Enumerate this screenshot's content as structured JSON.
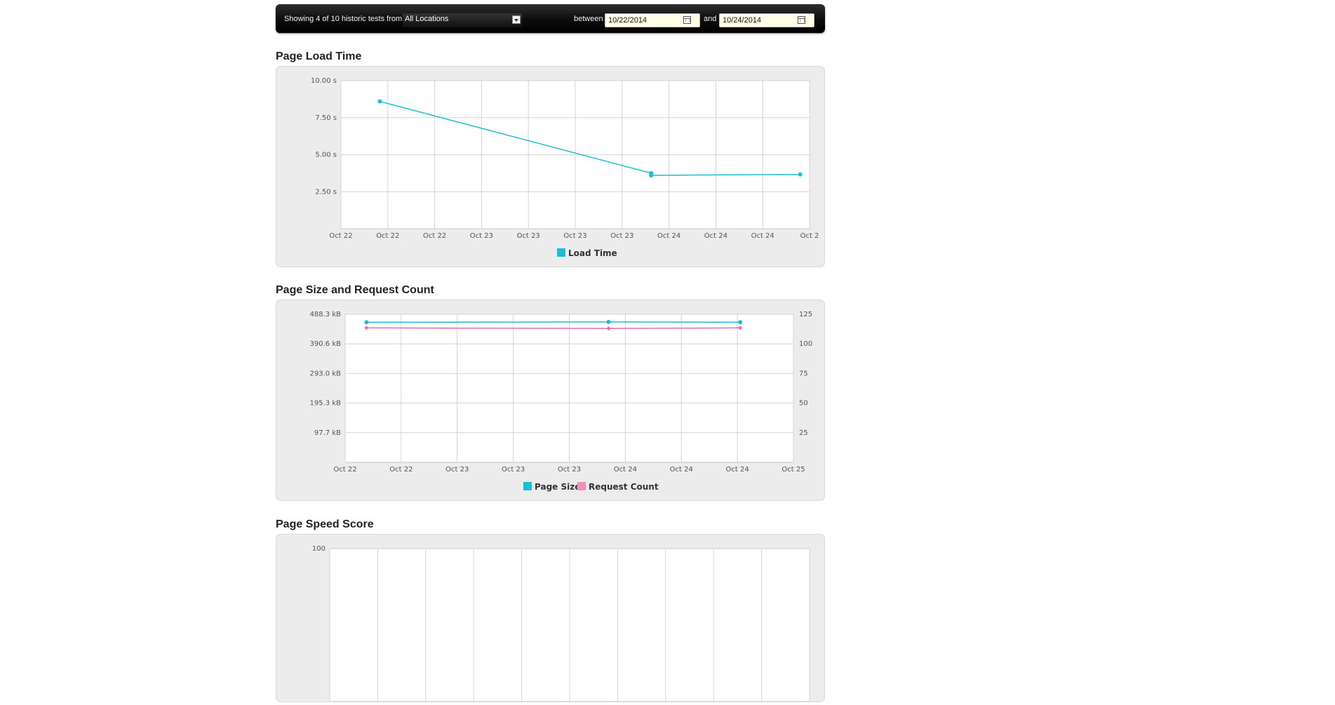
{
  "toolbar": {
    "showing_text": "Showing 4 of 10 historic tests from",
    "location_select": "All Locations",
    "between_label": "between",
    "start_date": "10/22/2014",
    "and_label": "and",
    "end_date": "10/24/2014",
    "calendar_icon": "calendar-icon"
  },
  "colors": {
    "cyan": "#1dbed0",
    "pink": "#e96ca6",
    "toolbar": "#111111",
    "panel": "#ececec"
  },
  "charts": {
    "load_time": {
      "heading": "Page Load Time"
    },
    "size_requests": {
      "heading": "Page Size and Request Count"
    },
    "speed": {
      "heading": "Page Speed Score"
    }
  },
  "chart_data": [
    {
      "type": "line",
      "title": "Page Load Time",
      "x_ticks": [
        "Oct 22",
        "Oct 22",
        "Oct 22",
        "Oct 23",
        "Oct 23",
        "Oct 23",
        "Oct 23",
        "Oct 24",
        "Oct 24",
        "Oct 24",
        "Oct 2"
      ],
      "y_ticks": [
        "10.00 s",
        "7.50 s",
        "5.00 s",
        "2.50 s"
      ],
      "ylim": [
        0,
        10
      ],
      "grid": true,
      "legend_position": "bottom",
      "series": [
        {
          "name": "Load Time",
          "color": "#1dbed0",
          "x": [
            0.83,
            6.62,
            6.62,
            9.8
          ],
          "y": [
            8.6,
            3.75,
            3.6,
            3.67
          ]
        }
      ]
    },
    {
      "type": "line",
      "title": "Page Size and Request Count",
      "x_ticks": [
        "Oct 22",
        "Oct 22",
        "Oct 23",
        "Oct 23",
        "Oct 23",
        "Oct 24",
        "Oct 24",
        "Oct 24",
        "Oct 25"
      ],
      "y_ticks_left": [
        "488.3 kB",
        "390.6 kB",
        "293.0 kB",
        "195.3 kB",
        "97.7 kB"
      ],
      "y_ticks_right": [
        "125",
        "100",
        "75",
        "50",
        "25"
      ],
      "ylim_left_kB": [
        0,
        488.3
      ],
      "ylim_right": [
        0,
        125
      ],
      "grid": true,
      "legend_position": "bottom",
      "series": [
        {
          "name": "Page Size",
          "axis": "left",
          "color": "#1dbed0",
          "x": [
            0.38,
            4.7,
            7.05
          ],
          "y": [
            462,
            463,
            462
          ]
        },
        {
          "name": "Request Count",
          "axis": "right",
          "color": "#e96ca6",
          "x": [
            0.38,
            4.7,
            7.05
          ],
          "y": [
            113.5,
            113,
            113.5
          ]
        }
      ]
    },
    {
      "type": "line",
      "title": "Page Speed Score",
      "y_ticks": [
        "100"
      ],
      "grid": true
    }
  ]
}
